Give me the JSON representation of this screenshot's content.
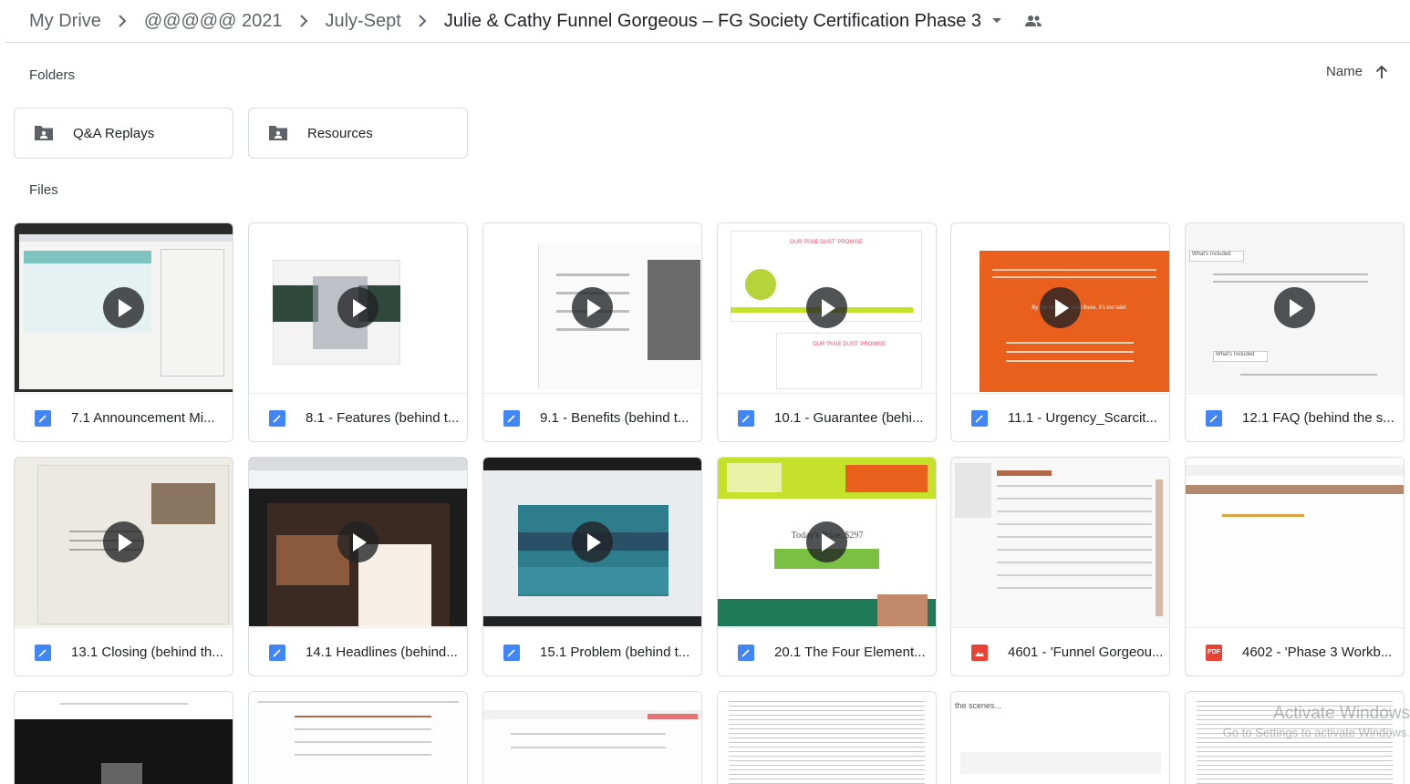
{
  "breadcrumb": {
    "items": [
      "My Drive",
      "@@@@@ 2021",
      "July-Sept"
    ],
    "current": "Julie & Cathy Funnel Gorgeous – FG Society Certification Phase 3"
  },
  "sections": {
    "folders": "Folders",
    "files": "Files"
  },
  "sort": {
    "label": "Name",
    "direction_icon": "arrow-up-icon"
  },
  "folders": [
    {
      "name": "Q&A Replays",
      "icon": "shared-folder-icon"
    },
    {
      "name": "Resources",
      "icon": "shared-folder-icon"
    }
  ],
  "files": [
    {
      "name": "7.1 Announcement Mi...",
      "type": "video"
    },
    {
      "name": "8.1 - Features (behind t...",
      "type": "video"
    },
    {
      "name": "9.1 - Benefits (behind t...",
      "type": "video"
    },
    {
      "name": "10.1 - Guarantee (behi...",
      "type": "video"
    },
    {
      "name": "11.1 - Urgency_Scarcit...",
      "type": "video"
    },
    {
      "name": "12.1 FAQ (behind the s...",
      "type": "video"
    },
    {
      "name": "13.1 Closing (behind th...",
      "type": "video"
    },
    {
      "name": "14.1 Headlines (behind...",
      "type": "video"
    },
    {
      "name": "15.1 Problem (behind t...",
      "type": "video"
    },
    {
      "name": "20.1 The Four Element...",
      "type": "video"
    },
    {
      "name": "4601 - 'Funnel Gorgeou...",
      "type": "image"
    },
    {
      "name": "4602 - 'Phase 3 Workb...",
      "type": "pdf"
    }
  ],
  "icons": {
    "pdf_label": "PDF"
  },
  "thumb_text": {
    "pixie_dust_promise": "OUR 'PIXIE DUST' PROMISE",
    "whats_included": "What's Included",
    "today_price": "Today's Price: $297",
    "by_the_time": "By the time you start there, it's too late!",
    "behind_scenes": "the scenes..."
  },
  "watermark": {
    "line1": "Activate Windows",
    "line2": "Go to Settings to activate Windows."
  },
  "colors": {
    "video_icon": "#4285f4",
    "image_icon": "#ea4335",
    "pdf_icon": "#ea4335",
    "orange_slide": "#e8601c",
    "lime_slide": "#c6e12a",
    "dark_slide": "#2e3b46"
  }
}
